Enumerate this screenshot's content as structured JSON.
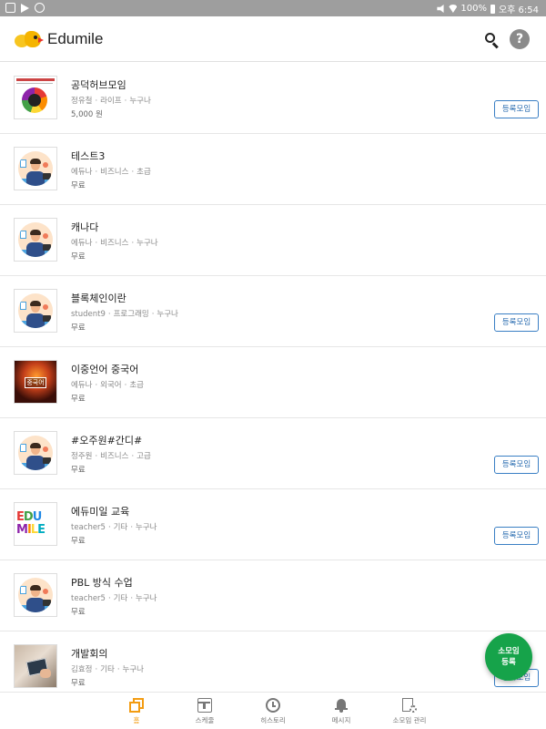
{
  "status_bar": {
    "battery": "100%",
    "time": "오후 6:54"
  },
  "app": {
    "title": "Edumile"
  },
  "items": [
    {
      "title": "공덕허브모임",
      "meta": [
        "정유철",
        "라이프",
        "누구나"
      ],
      "price": "5,000 원",
      "button": "등록모임",
      "thumb": "chart"
    },
    {
      "title": "테스트3",
      "meta": [
        "에듀나",
        "비즈니스",
        "초급"
      ],
      "price": "무료",
      "button": "",
      "thumb": "avatar"
    },
    {
      "title": "캐나다",
      "meta": [
        "에듀나",
        "비즈니스",
        "누구나"
      ],
      "price": "무료",
      "button": "",
      "thumb": "avatar"
    },
    {
      "title": "블록체인이란",
      "meta": [
        "student9",
        "프로그래밍",
        "누구나"
      ],
      "price": "무료",
      "button": "등록모임",
      "thumb": "avatar"
    },
    {
      "title": "이중언어 중국어",
      "meta": [
        "에듀나",
        "외국어",
        "초급"
      ],
      "price": "무료",
      "button": "",
      "thumb": "chinese",
      "thumb_text": "중국어"
    },
    {
      "title": "#오주원#간디#",
      "meta": [
        "정주원",
        "비즈니스",
        "고급"
      ],
      "price": "무료",
      "button": "등록모임",
      "thumb": "avatar"
    },
    {
      "title": "에듀미일 교육",
      "meta": [
        "teacher5",
        "기타",
        "누구나"
      ],
      "price": "무료",
      "button": "등록모임",
      "thumb": "edumile"
    },
    {
      "title": "PBL 방식 수업",
      "meta": [
        "teacher5",
        "기타",
        "누구나"
      ],
      "price": "무료",
      "button": "",
      "thumb": "avatar"
    },
    {
      "title": "개발회의",
      "meta": [
        "김효정",
        "기타",
        "누구나"
      ],
      "price": "무료",
      "button": "등록모임",
      "thumb": "photo"
    }
  ],
  "fab": {
    "line1": "소모임",
    "line2": "등록"
  },
  "bottom_nav": [
    {
      "label": "홈",
      "icon": "home-icon",
      "active": true
    },
    {
      "label": "스케줄",
      "icon": "calendar-icon",
      "active": false
    },
    {
      "label": "히스토리",
      "icon": "history-icon",
      "active": false
    },
    {
      "label": "메시지",
      "icon": "bell-icon",
      "active": false
    },
    {
      "label": "소모임 관리",
      "icon": "manage-icon",
      "active": false
    }
  ],
  "colors": {
    "accent_orange": "#f39c12",
    "fab_green": "#16a34a",
    "button_blue": "#2a6cb0"
  }
}
